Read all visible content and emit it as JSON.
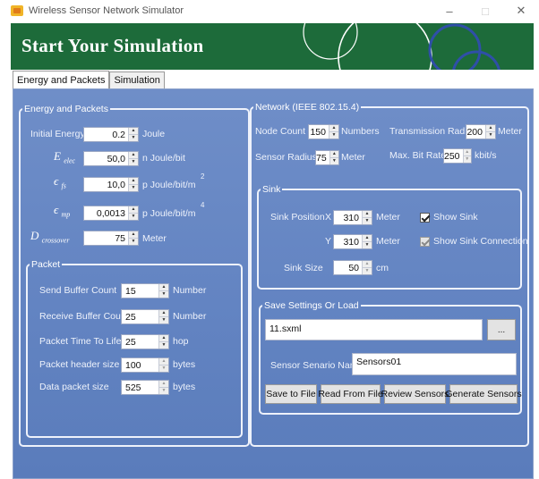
{
  "window": {
    "title": "Wireless Sensor Network Simulator",
    "minimize": "–",
    "maximize": "□",
    "close": "✕"
  },
  "banner": {
    "title": "Start Your Simulation"
  },
  "tabs": [
    {
      "label": "Energy and Packets"
    },
    {
      "label": "Simulation"
    }
  ],
  "energy": {
    "legend": "Energy and Packets",
    "initial_energy": {
      "label": "Initial Energy",
      "value": "0.2",
      "unit": "Joule"
    },
    "e_elec": {
      "symbol": "E",
      "sub": "elec",
      "value": "50,0",
      "unit": "n Joule/bit"
    },
    "e_fs": {
      "symbol": "ϵ",
      "sub": "fs",
      "value": "10,0",
      "unit": "p Joule/bit/m",
      "exp": "2"
    },
    "e_mp": {
      "symbol": "ϵ",
      "sub": "mp",
      "value": "0,0013",
      "unit": "p Joule/bit/m",
      "exp": "4"
    },
    "d_crossover": {
      "symbol": "D",
      "sub": "crossover",
      "value": "75",
      "unit": "Meter"
    }
  },
  "packet": {
    "legend": "Packet",
    "send_buffer": {
      "label": "Send Buffer Count",
      "value": "15",
      "unit": "Number"
    },
    "receive_buffer": {
      "label": "Receive Buffer Count",
      "value": "25",
      "unit": "Number"
    },
    "ttl": {
      "label": "Packet Time To Life",
      "value": "25",
      "unit": "hop"
    },
    "header_size": {
      "label": "Packet header size",
      "value": "100",
      "unit": "bytes"
    },
    "data_size": {
      "label": "Data packet size",
      "value": "525",
      "unit": "bytes"
    }
  },
  "network": {
    "legend": "Network (IEEE 802.15.4)",
    "node_count": {
      "label": "Node Count",
      "value": "150",
      "unit": "Numbers"
    },
    "tx_radius": {
      "label": "Transmission Radius",
      "value": "200",
      "unit": "Meter"
    },
    "sensor_radius": {
      "label": "Sensor Radius",
      "value": "75",
      "unit": "Meter"
    },
    "bit_rate": {
      "label": "Max. Bit Rate",
      "value": "250",
      "unit": "kbit/s"
    }
  },
  "sink": {
    "legend": "Sink",
    "position_label": "Sink Position",
    "x_label": "X",
    "x_value": "310",
    "x_unit": "Meter",
    "y_label": "Y",
    "y_value": "310",
    "y_unit": "Meter",
    "size_label": "Sink Size",
    "size_value": "50",
    "size_unit": "cm",
    "show_sink": "Show Sink",
    "show_connection": "Show Sink Connection"
  },
  "save": {
    "legend": "Save Settings Or Load",
    "file_value": "11.sxml",
    "browse_label": "...",
    "scenario_label": "Sensor Senario Name",
    "scenario_value": "Sensors01",
    "buttons": {
      "save": "Save to File",
      "read": "Read From File",
      "review": "Review Sensors",
      "generate": "Generate Sensors"
    }
  },
  "colors": {
    "banner": "#1d6b3a",
    "panel": "#6384c2",
    "accent_ring": "#2f4fa8"
  }
}
